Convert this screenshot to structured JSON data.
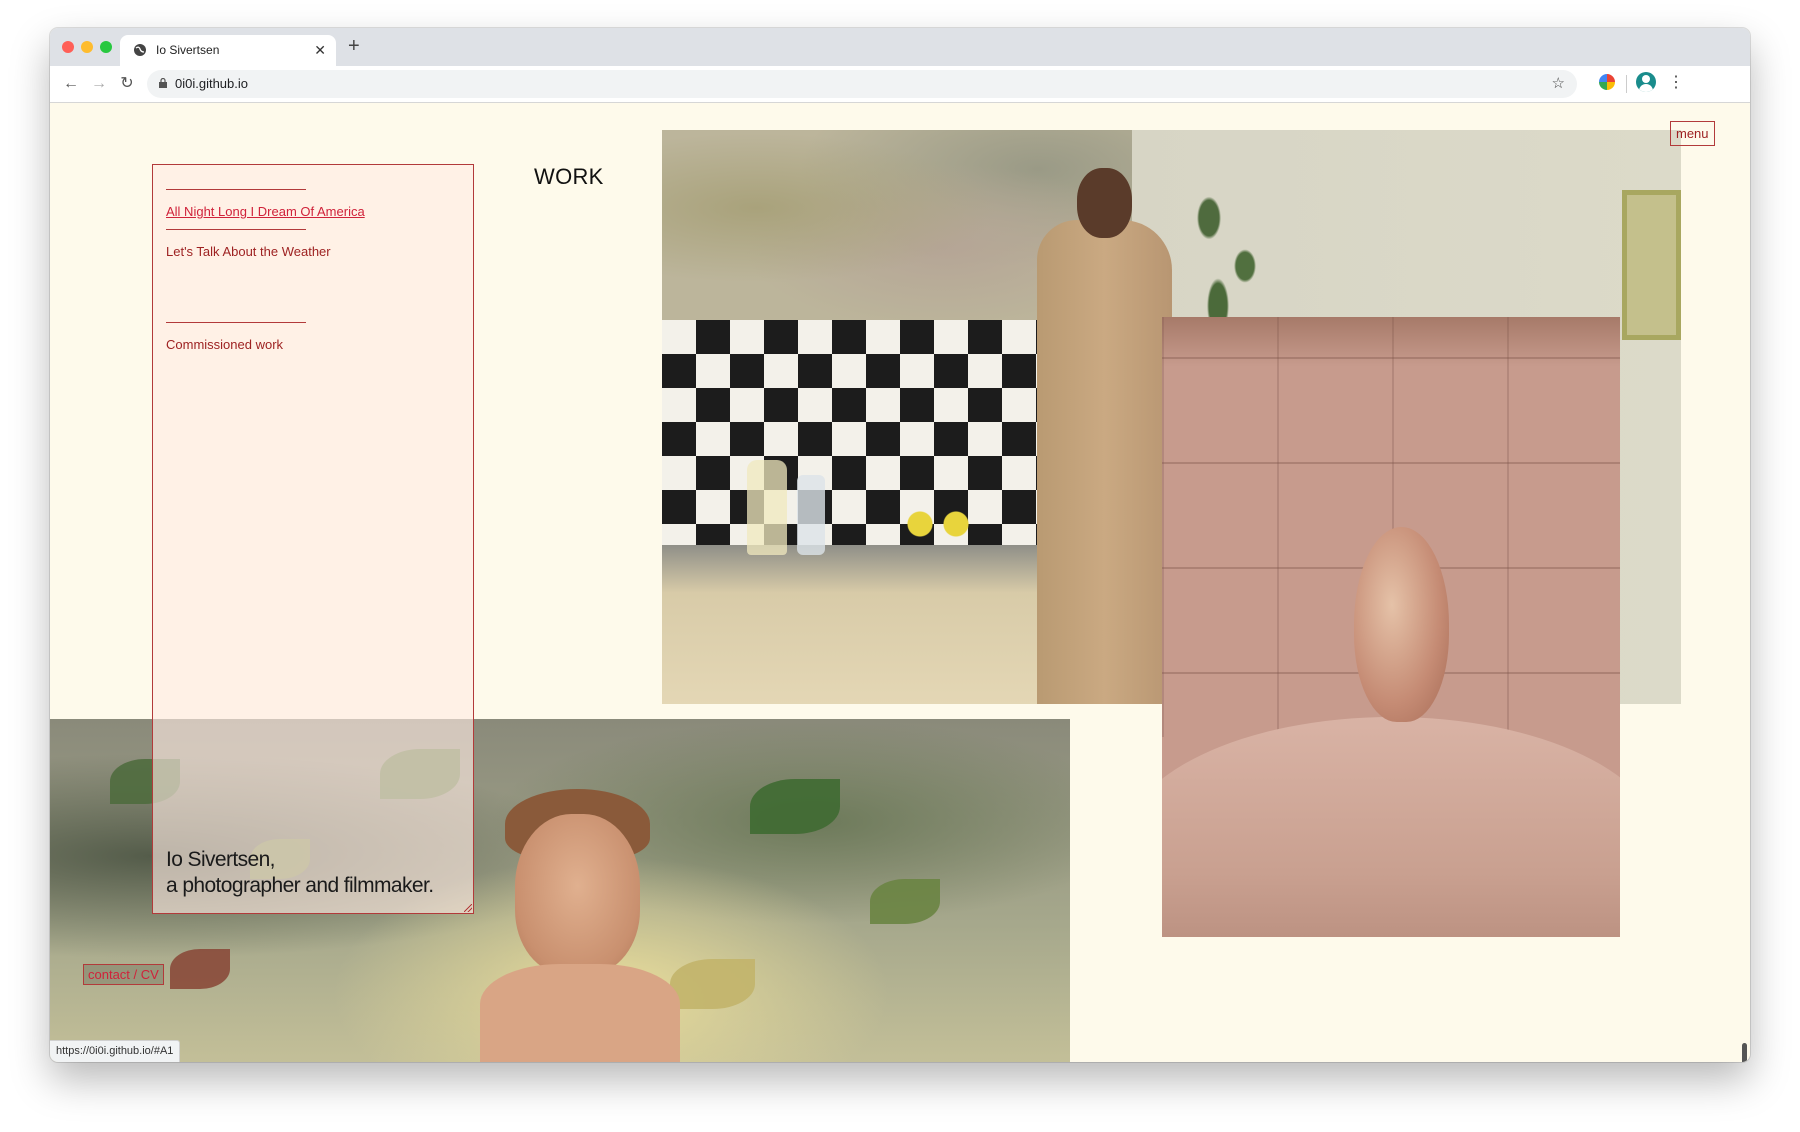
{
  "browser": {
    "tab_title": "Io Sivertsen",
    "url": "0i0i.github.io",
    "status_url": "https://0i0i.github.io/#A1"
  },
  "page": {
    "menu_button": "menu",
    "section_title": "WORK",
    "nav_items": [
      {
        "label": "All Night Long I Dream Of America",
        "active": true
      },
      {
        "label": "Let's Talk About the Weather",
        "active": false
      },
      {
        "label": "Commissioned work",
        "active": false
      }
    ],
    "intro_line1": "Io Sivertsen,",
    "intro_line2": "a photographer and filmmaker.",
    "contact_links": "contact / CV"
  },
  "colors": {
    "page_background": "#fefaeb",
    "accent": "#b23a3a",
    "active_link": "#d0223a"
  }
}
